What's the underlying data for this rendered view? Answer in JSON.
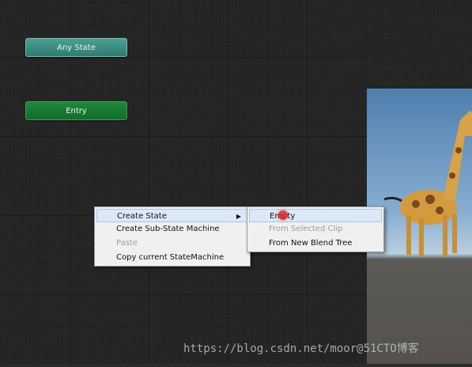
{
  "graph": {
    "any_state_label": "Any State",
    "entry_label": "Entry"
  },
  "context_menu": {
    "items": [
      {
        "label": "Create State",
        "highlighted": true,
        "has_submenu": true
      },
      {
        "label": "Create Sub-State Machine"
      },
      {
        "label": "Paste",
        "disabled": true
      },
      {
        "label": "Copy current StateMachine"
      }
    ],
    "submenu_arrow_icon": "triangle-right-icon"
  },
  "submenu": {
    "items": [
      {
        "label": "Empty",
        "highlighted": true
      },
      {
        "label": "From Selected Clip",
        "disabled": true
      },
      {
        "label": "From New Blend Tree"
      }
    ]
  },
  "watermark": "https://blog.csdn.net/moor@51CTO博客",
  "colors": {
    "any_state": "#3f8f82",
    "entry": "#1a7d33",
    "menu_bg": "#f0f0f0",
    "highlight": "#dbe9f7"
  }
}
